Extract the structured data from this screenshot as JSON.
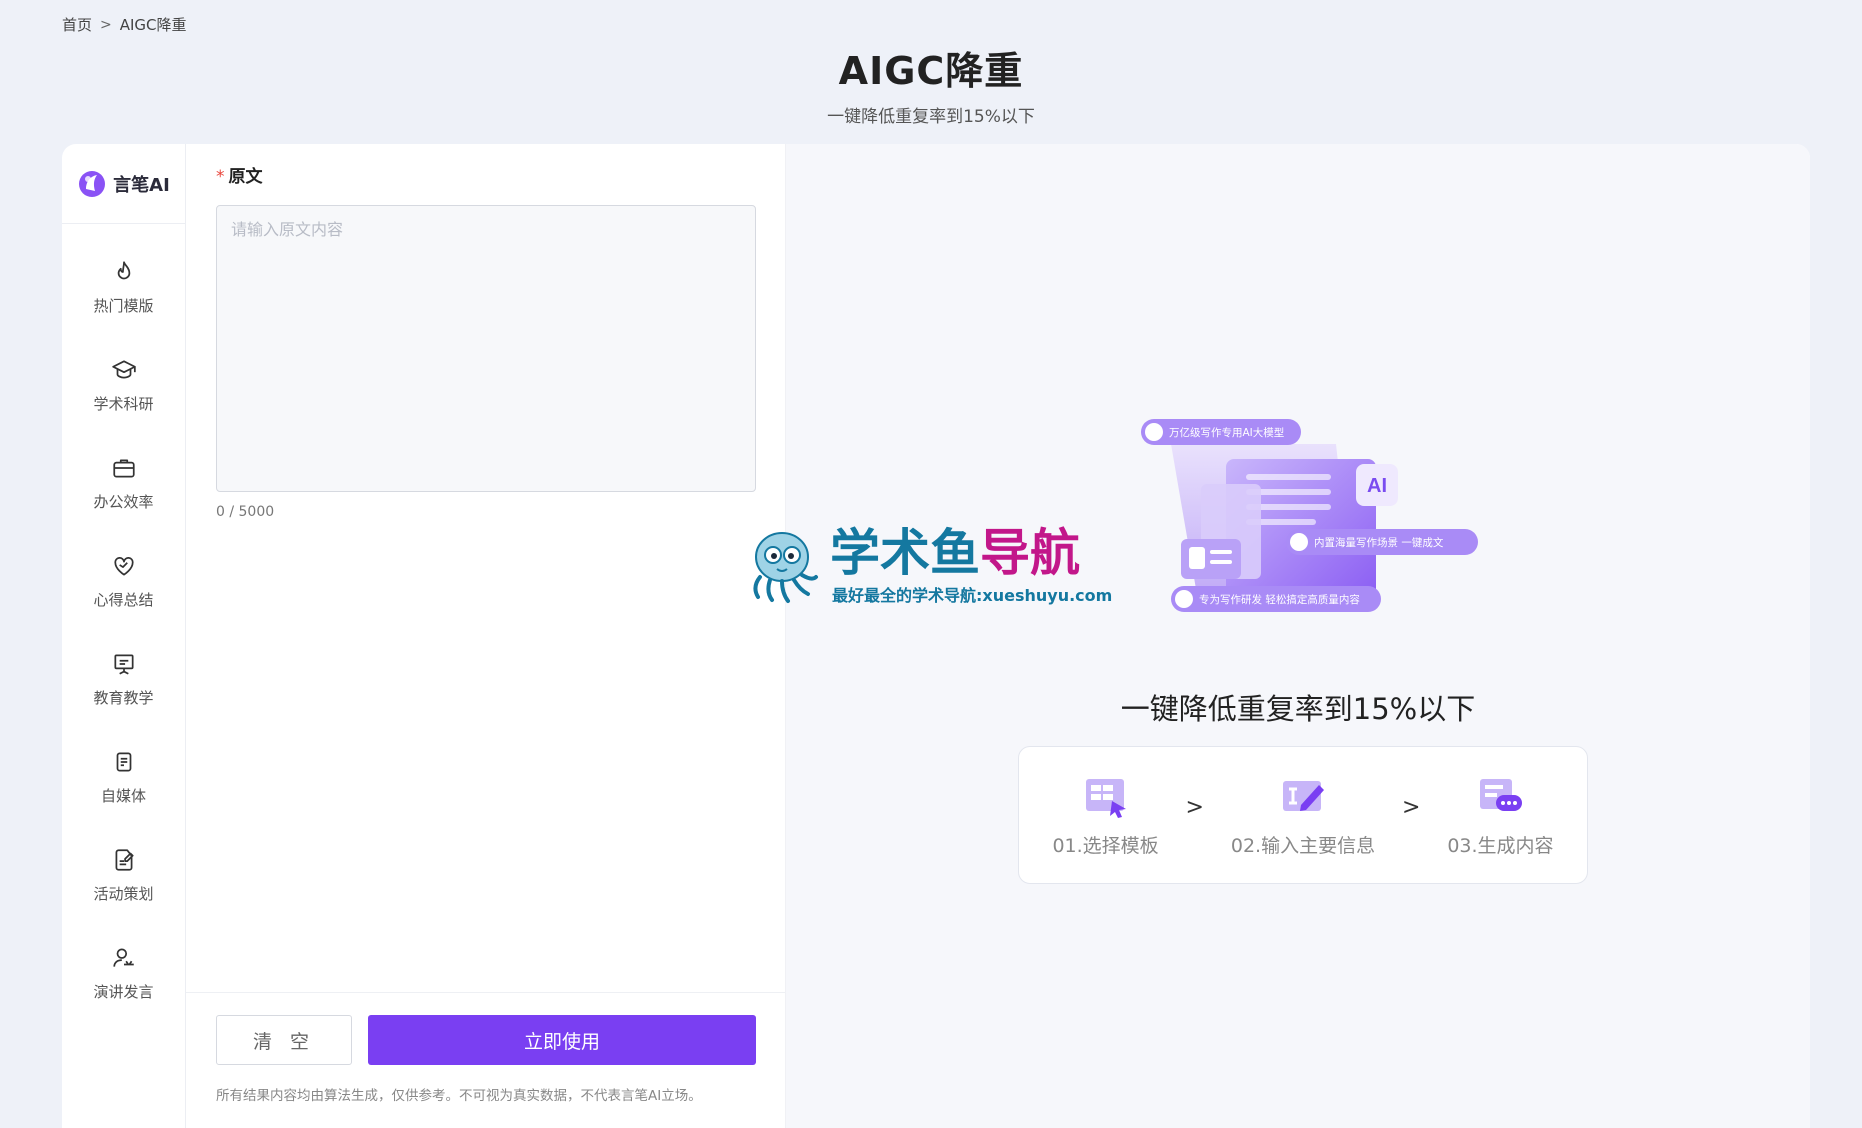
{
  "breadcrumb": {
    "home": "首页",
    "separator": ">",
    "current": "AIGC降重"
  },
  "page": {
    "title": "AIGC降重",
    "subtitle": "一键降低重复率到15%以下"
  },
  "logo": {
    "text": "言笔AI"
  },
  "sidebar": {
    "items": [
      {
        "label": "热门模版",
        "icon": "flame-icon"
      },
      {
        "label": "学术科研",
        "icon": "graduation-cap-icon"
      },
      {
        "label": "办公效率",
        "icon": "briefcase-icon"
      },
      {
        "label": "心得总结",
        "icon": "heart-hand-icon"
      },
      {
        "label": "教育教学",
        "icon": "presentation-board-icon"
      },
      {
        "label": "自媒体",
        "icon": "document-icon"
      },
      {
        "label": "活动策划",
        "icon": "edit-document-icon"
      },
      {
        "label": "演讲发言",
        "icon": "speaker-icon"
      }
    ]
  },
  "form": {
    "label": "原文",
    "required_mark": "*",
    "placeholder": "请输入原文内容",
    "value": "",
    "counter": "0 / 5000",
    "clear_label": "清 空",
    "submit_label": "立即使用",
    "disclaimer": "所有结果内容均由算法生成，仅供参考。不可视为真实数据，不代表言笔AI立场。"
  },
  "preview": {
    "illustration": {
      "tag1": "万亿级写作专用AI大模型",
      "tag2": "内置海量写作场景 一键成文",
      "tag3": "专为写作研发 轻松搞定高质量内容",
      "ai_badge": "AI"
    },
    "hero_title": "一键降低重复率到15%以下",
    "steps": [
      {
        "label": "01.选择模板",
        "icon": "template-grid-icon"
      },
      {
        "label": "02.输入主要信息",
        "icon": "input-edit-icon"
      },
      {
        "label": "03.生成内容",
        "icon": "chat-generate-icon"
      }
    ],
    "step_separator": ">"
  },
  "watermark": {
    "title_a": "学术鱼",
    "title_b": "导航",
    "subtitle": "最好最全的学术导航:xueshuyu.com"
  },
  "colors": {
    "accent": "#7a3ff2",
    "watermark_blue": "#1478a0",
    "watermark_pink": "#c2178a"
  }
}
